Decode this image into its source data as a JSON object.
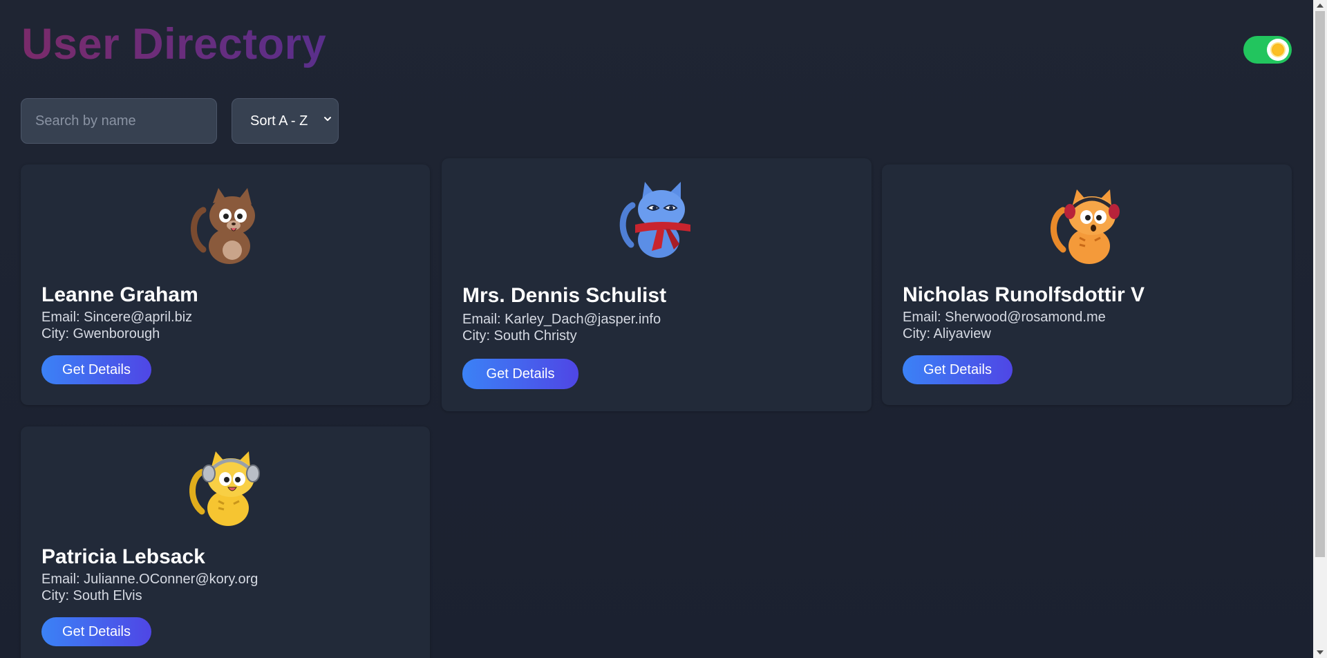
{
  "header": {
    "title": "User Directory"
  },
  "controls": {
    "search_placeholder": "Search by name",
    "search_value": "",
    "sort_selected": "Sort A - Z"
  },
  "theme_toggle": {
    "state": "on",
    "color": "#22c55e",
    "icon": "sun-icon"
  },
  "users": [
    {
      "name": "Leanne Graham",
      "email": "Email: Sincere@april.biz",
      "city": "City: Gwenborough",
      "button": "Get Details",
      "avatar": "brown-cat-avatar",
      "avatar_color": "#8a5a3c"
    },
    {
      "name": "Mrs. Dennis Schulist",
      "email": "Email: Karley_Dach@jasper.info",
      "city": "City: South Christy",
      "button": "Get Details",
      "avatar": "blue-cat-red-scarf-avatar",
      "avatar_color": "#5b8ee6"
    },
    {
      "name": "Nicholas Runolfsdottir V",
      "email": "Email: Sherwood@rosamond.me",
      "city": "City: Aliyaview",
      "button": "Get Details",
      "avatar": "orange-cat-headphones-avatar",
      "avatar_color": "#f49a3a"
    },
    {
      "name": "Patricia Lebsack",
      "email": "Email: Julianne.OConner@kory.org",
      "city": "City: South Elvis",
      "button": "Get Details",
      "avatar": "yellow-cat-headphones-avatar",
      "avatar_color": "#f6c531"
    }
  ],
  "colors": {
    "background": "#1c2230",
    "card": "#222a39",
    "button_start": "#3b82f6",
    "button_end": "#4f46e5",
    "title_start": "#7a2b6a",
    "title_end": "#5a2f8c"
  }
}
